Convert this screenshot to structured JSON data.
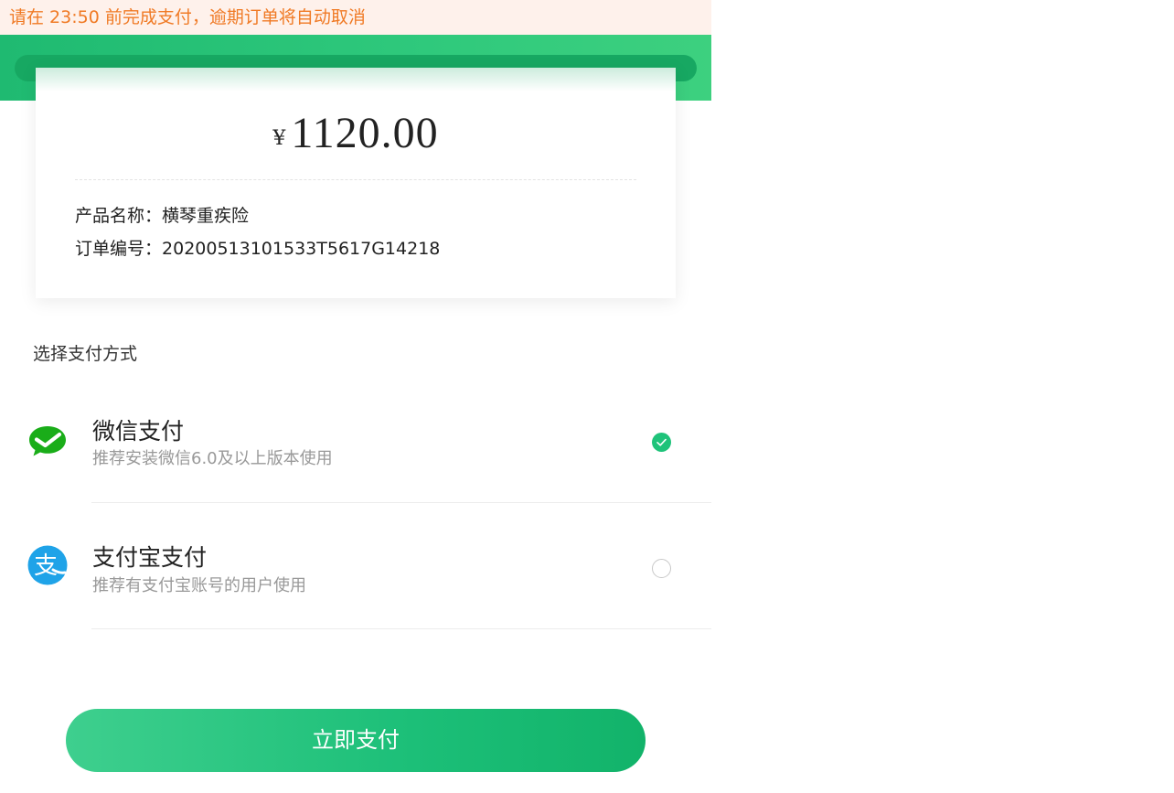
{
  "notice": {
    "text": "请在 23:50 前完成支付，逾期订单将自动取消"
  },
  "order": {
    "currency_symbol": "¥",
    "amount": "1120.00",
    "product_label": "产品名称：",
    "product_value": "横琴重疾险",
    "order_no_label": "订单编号：",
    "order_no_value": "20200513101533T5617G14218"
  },
  "payment": {
    "section_title": "选择支付方式",
    "methods": [
      {
        "name": "微信支付",
        "desc": "推荐安装微信6.0及以上版本使用",
        "icon": "wechat-icon",
        "selected": true
      },
      {
        "name": "支付宝支付",
        "desc": "推荐有支付宝账号的用户使用",
        "icon": "alipay-icon",
        "selected": false
      }
    ]
  },
  "actions": {
    "pay_now_label": "立即支付"
  },
  "colors": {
    "brand_green": "#1fba71",
    "notice_text": "#f07a25",
    "notice_bg": "#fef1eb",
    "wechat_green": "#1aad19",
    "alipay_blue": "#1fa3e8"
  }
}
